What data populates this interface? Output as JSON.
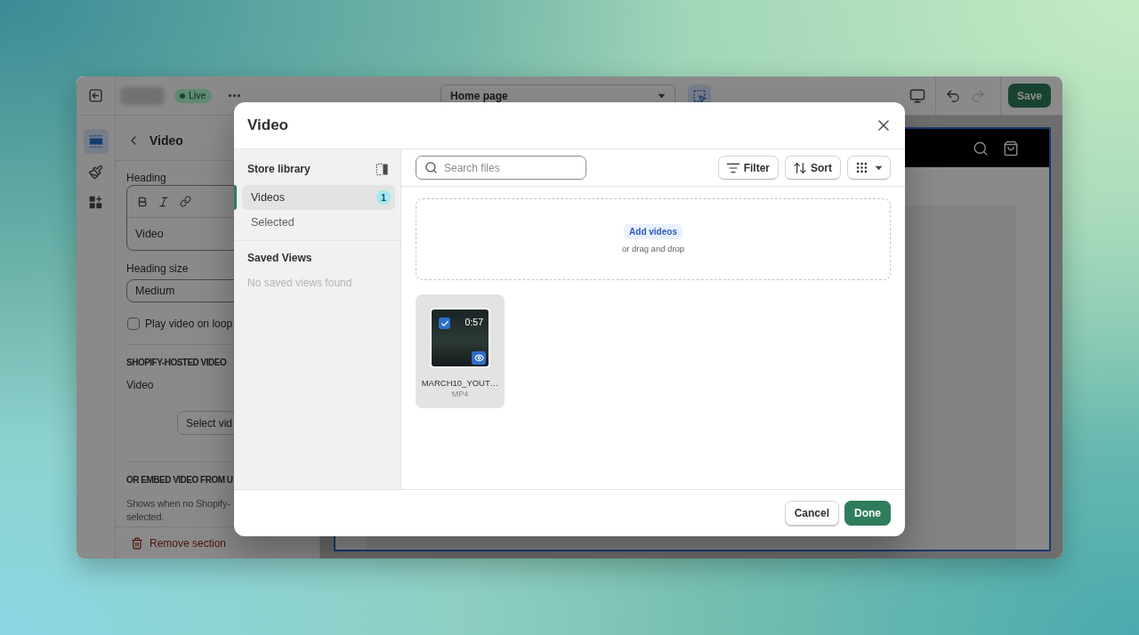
{
  "topbar": {
    "status": "Live",
    "page_select": {
      "value": "Home page"
    },
    "inspector": {
      "selected": true
    },
    "history": [
      {
        "kind": "undo",
        "disabled": false
      },
      {
        "kind": "redo",
        "disabled": true
      }
    ],
    "save_button": "Save"
  },
  "rail": [
    {
      "kind": "sections",
      "selected": true
    },
    {
      "kind": "theme",
      "selected": false
    },
    {
      "kind": "apps",
      "selected": false
    }
  ],
  "settings": {
    "title": "Video",
    "heading": {
      "label": "Heading",
      "value": "Video"
    },
    "heading_size": {
      "label": "Heading size",
      "value": "Medium"
    },
    "loop": {
      "label": "Play video on loop",
      "checked": false
    },
    "hosted_video": {
      "title": "SHOPIFY-HOSTED VIDEO",
      "label": "Video",
      "button": "Select vid"
    },
    "embed": {
      "title": "OR EMBED VIDEO FROM U",
      "help": "Shows when no Shopify-\nselected."
    },
    "remove_button": "Remove section"
  },
  "dialog": {
    "title": "Video",
    "sidebar": {
      "title": "Store library",
      "items": [
        {
          "label": "Videos",
          "count": "1",
          "selected": true
        },
        {
          "label": "Selected",
          "selected": false
        }
      ],
      "saved_views": {
        "title": "Saved Views",
        "empty": "No saved views found"
      }
    },
    "search": {
      "placeholder": "Search files"
    },
    "actions": [
      {
        "kind": "filter",
        "label": "Filter"
      },
      {
        "kind": "sort",
        "label": "Sort"
      },
      {
        "kind": "view"
      }
    ],
    "dropzone": {
      "button": "Add videos",
      "hint": "or drag and drop"
    },
    "files": [
      {
        "name": "MARCH10_YOUT…",
        "type": "MP4",
        "duration": "0:57",
        "selected": true
      }
    ],
    "buttons": [
      {
        "kind": "secondary",
        "label": "Cancel"
      },
      {
        "kind": "primary",
        "label": "Done"
      }
    ]
  }
}
